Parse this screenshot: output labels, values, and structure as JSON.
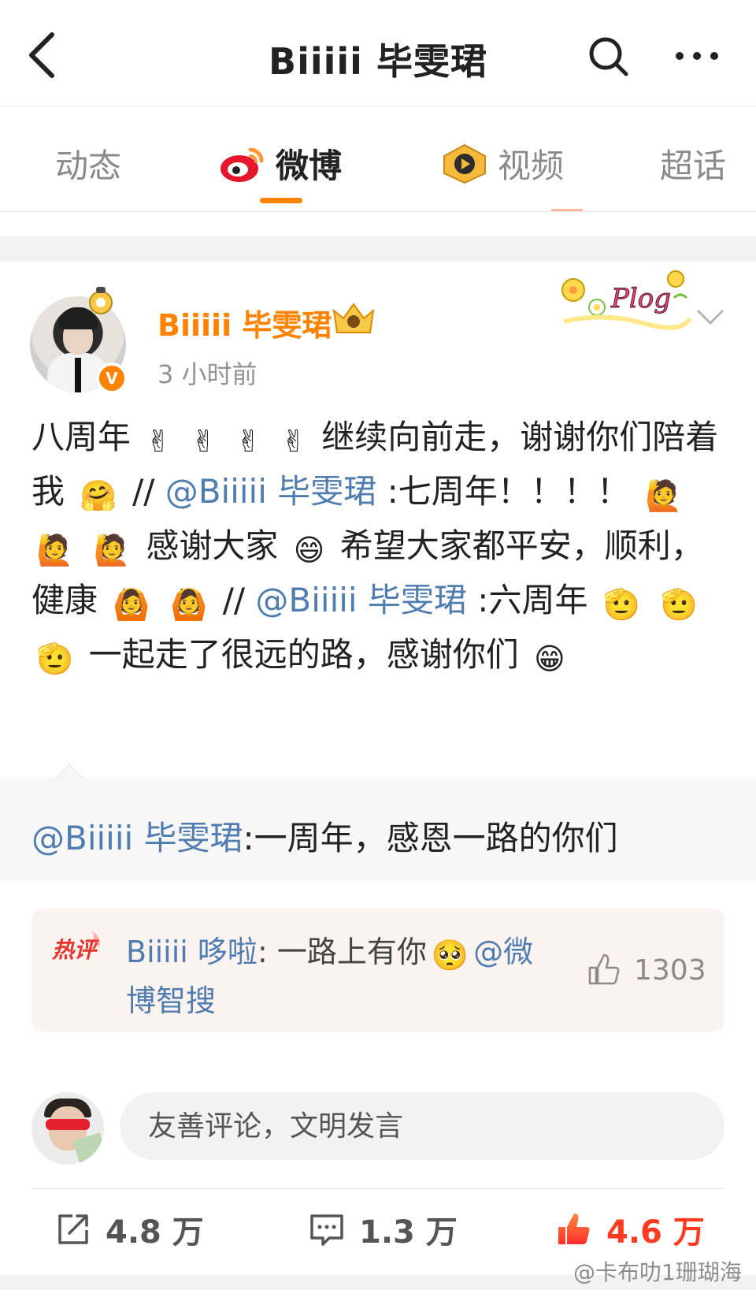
{
  "nav": {
    "title": "Biiiii 毕雯珺"
  },
  "tabs": [
    {
      "label": "动态"
    },
    {
      "label": "微博"
    },
    {
      "label": "视频"
    },
    {
      "label": "超话"
    }
  ],
  "post": {
    "username": "Biiiii 毕雯珺",
    "time": "3 小时前",
    "sticker": "Plog",
    "verified_mark": "V",
    "text_segments": {
      "s1": "八周年",
      "s2": "继续向前走，谢谢你们陪着我",
      "s3": "//",
      "s4": "@Biiiii 毕雯珺",
      "s5": ":七周年！！！！ ",
      "s6": "感谢大家",
      "s7": "希望大家都平安，顺利，健康",
      "s8": "//",
      "s9": "@Biiiii 毕雯珺",
      "s10": ":六周年",
      "s11": "一起走了很远的路，感谢你们"
    },
    "emojis": {
      "victory": "✌",
      "hug": "🤗",
      "raise": "🙋",
      "laugh": "😄",
      "ok": "🙆",
      "salute": "🫡",
      "grin": "😁"
    }
  },
  "repost": {
    "mention": "@Biiiii 毕雯珺",
    "text": ":一周年，感恩一路的你们"
  },
  "hot_comment": {
    "badge": "热评",
    "user": "Biiiii 哆啦",
    "text_prefix": ": 一路上有你",
    "emoji": "🥺",
    "text_suffix": "@微博智搜",
    "likes": "1303"
  },
  "comment_input": {
    "placeholder": "友善评论，文明发言"
  },
  "actions": {
    "repost_count": "4.8 万",
    "comment_count": "1.3 万",
    "like_count": "4.6 万"
  },
  "watermark": "@卡布叻1珊瑚海",
  "colors": {
    "accent_orange": "#ff8200",
    "link_blue": "#507daf",
    "like_red": "#ff3b1f"
  }
}
